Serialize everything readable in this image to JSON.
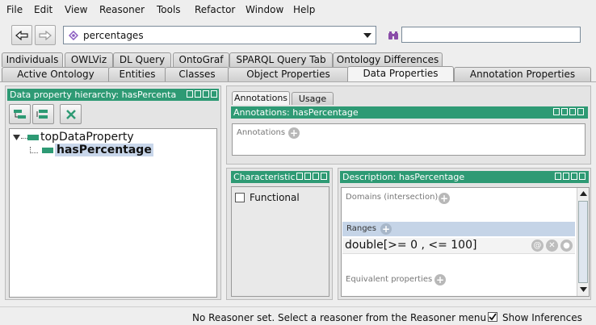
{
  "menu": [
    "File",
    "Edit",
    "View",
    "Reasoner",
    "Tools",
    "Refactor",
    "Window",
    "Help"
  ],
  "toolbar": {
    "ontology": "percentages",
    "search_value": ""
  },
  "tabs_row1": [
    "Individuals",
    "OWLViz",
    "DL Query",
    "OntoGraf",
    "SPARQL Query Tab",
    "Ontology Differences"
  ],
  "tabs_row2": [
    "Active Ontology",
    "Entities",
    "Classes",
    "Object Properties",
    "Data Properties",
    "Annotation Properties"
  ],
  "left_panel": {
    "title": "Data property hierarchy: hasPercenta",
    "tree": [
      "topDataProperty",
      "hasPercentage"
    ]
  },
  "annot_tabs": [
    "Annotations",
    "Usage"
  ],
  "annotations_panel": {
    "title": "Annotations: hasPercentage",
    "section": "Annotations"
  },
  "characteristics_panel": {
    "title": "Characteristic",
    "functional": "Functional"
  },
  "description_panel": {
    "title": "Description: hasPercentage",
    "domains": "Domains (intersection)",
    "ranges": "Ranges",
    "range_value": "double[>= 0 , <= 100]",
    "equivalent": "Equivalent properties"
  },
  "status": {
    "message": "No Reasoner set. Select a reasoner from the Reasoner menu",
    "show_inferences": "Show Inferences"
  },
  "colors": {
    "accent": "#2e9a74",
    "selection": "#c8d6ea"
  }
}
